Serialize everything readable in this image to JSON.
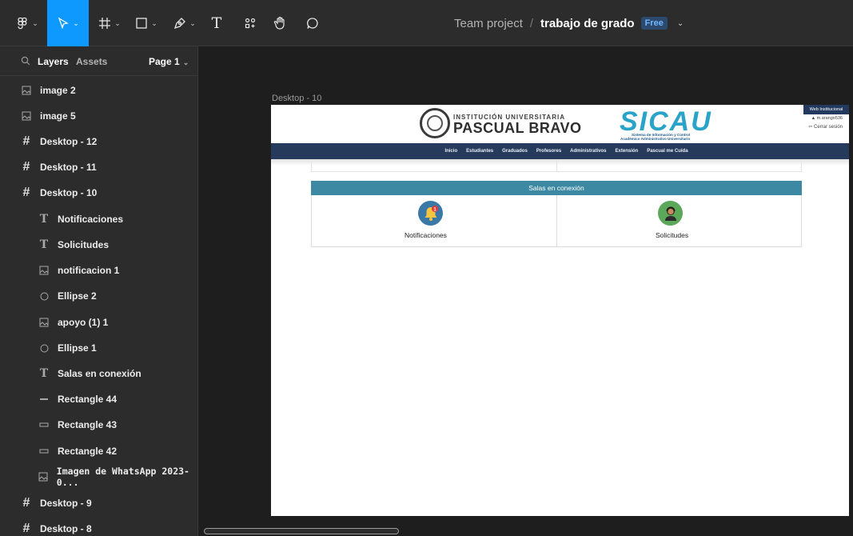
{
  "toolbar": {
    "tools": [
      "main-menu",
      "move",
      "frame",
      "shape",
      "pen",
      "text",
      "resources",
      "hand",
      "comment"
    ],
    "team": "Team project",
    "separator": "/",
    "file": "trabajo de grado",
    "plan_badge": "Free",
    "accent_color": "#0d99ff"
  },
  "sidebar": {
    "tab_layers": "Layers",
    "tab_assets": "Assets",
    "page": "Page 1",
    "layers": [
      {
        "icon": "image-icon",
        "label": "image 2"
      },
      {
        "icon": "image-icon",
        "label": "image 5"
      },
      {
        "icon": "frame-icon",
        "label": "Desktop - 12"
      },
      {
        "icon": "frame-icon",
        "label": "Desktop - 11"
      },
      {
        "icon": "frame-icon",
        "label": "Desktop - 10"
      },
      {
        "icon": "text-icon",
        "label": "Notificaciones"
      },
      {
        "icon": "text-icon",
        "label": "Solicitudes"
      },
      {
        "icon": "image-icon",
        "label": "notificacion 1"
      },
      {
        "icon": "ellipse-icon",
        "label": "Ellipse 2"
      },
      {
        "icon": "image-icon",
        "label": "apoyo (1) 1"
      },
      {
        "icon": "ellipse-icon",
        "label": "Ellipse 1"
      },
      {
        "icon": "text-icon",
        "label": "Salas en conexión"
      },
      {
        "icon": "line-icon",
        "label": "Rectangle 44"
      },
      {
        "icon": "rectangle-icon",
        "label": "Rectangle 43"
      },
      {
        "icon": "rectangle-icon",
        "label": "Rectangle 42"
      },
      {
        "icon": "image-icon",
        "label": "Imagen de WhatsApp 2023-0..."
      },
      {
        "icon": "frame-icon",
        "label": "Desktop - 9"
      },
      {
        "icon": "frame-icon",
        "label": "Desktop - 8"
      }
    ]
  },
  "canvas": {
    "frame_label": "Desktop - 10",
    "site": {
      "inst_small": "INSTITUCIÓN UNIVERSITARIA",
      "inst_big": "PASCUAL BRAVO",
      "sicau": "SICAU",
      "sicau_sub1": "Sistema de Información y Control",
      "sicau_sub2": "Académico Administrativo Universitario",
      "web_inst": "Web Institucional",
      "user": "m.arango536",
      "logout": "Cerrar sesión",
      "nav": [
        "Inicio",
        "Estudiantes",
        "Graduados",
        "Profesores",
        "Administrativos",
        "Extensión",
        "Pascual me Cuida"
      ],
      "salas_title": "Salas en conexión",
      "cell1_label": "Notificaciones",
      "cell2_label": "Solicitudes",
      "navbar_color": "#263a5c",
      "salas_color": "#3d89a3"
    }
  }
}
